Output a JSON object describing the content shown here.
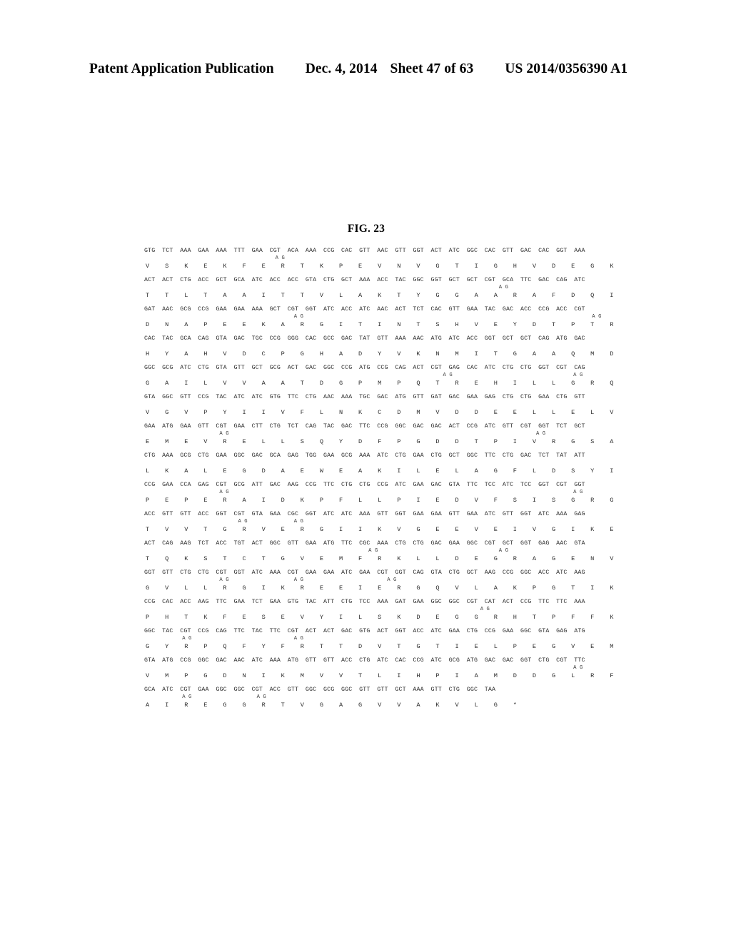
{
  "header": {
    "publication": "Patent Application Publication",
    "date": "Dec. 4, 2014",
    "sheet": "Sheet 47 of 63",
    "document_number": "US 2014/0356390 A1"
  },
  "figure": {
    "title": "FIG. 23",
    "mutation_annotation": "A G",
    "stop_symbol": "*",
    "rows": [
      {
        "codons": [
          "GTG",
          "TCT",
          "AAA",
          "GAA",
          "AAA",
          "TTT",
          "GAA",
          "CGT",
          "ACA",
          "AAA",
          "CCG",
          "CAC",
          "GTT",
          "AAC",
          "GTT",
          "GGT",
          "ACT",
          "ATC",
          "GGC",
          "CAC",
          "GTT",
          "GAC",
          "CAC",
          "GGT",
          "AAA"
        ],
        "mutations": [
          7
        ],
        "aminos": [
          "V",
          "S",
          "K",
          "E",
          "K",
          "F",
          "E",
          "R",
          "T",
          "K",
          "P",
          "E",
          "V",
          "N",
          "V",
          "G",
          "T",
          "I",
          "G",
          "H",
          "V",
          "D",
          "E",
          "G",
          "K"
        ]
      },
      {
        "codons": [
          "ACT",
          "ACT",
          "CTG",
          "ACC",
          "GCT",
          "GCA",
          "ATC",
          "ACC",
          "ACC",
          "GTA",
          "CTG",
          "GCT",
          "AAA",
          "ACC",
          "TAC",
          "GGC",
          "GGT",
          "GCT",
          "GCT",
          "CGT",
          "GCA",
          "TTC",
          "GAC",
          "CAG",
          "ATC"
        ],
        "mutations": [
          19
        ],
        "aminos": [
          "T",
          "T",
          "L",
          "T",
          "A",
          "A",
          "I",
          "T",
          "T",
          "V",
          "L",
          "A",
          "K",
          "T",
          "Y",
          "G",
          "G",
          "A",
          "A",
          "R",
          "A",
          "F",
          "D",
          "Q",
          "I"
        ]
      },
      {
        "codons": [
          "GAT",
          "AAC",
          "GCG",
          "CCG",
          "GAA",
          "GAA",
          "AAA",
          "GCT",
          "CGT",
          "GGT",
          "ATC",
          "ACC",
          "ATC",
          "AAC",
          "ACT",
          "TCT",
          "CAC",
          "GTT",
          "GAA",
          "TAC",
          "GAC",
          "ACC",
          "CCG",
          "ACC",
          "CGT"
        ],
        "mutations": [
          8,
          24
        ],
        "aminos": [
          "D",
          "N",
          "A",
          "P",
          "E",
          "E",
          "K",
          "A",
          "R",
          "G",
          "I",
          "T",
          "I",
          "N",
          "T",
          "S",
          "H",
          "V",
          "E",
          "Y",
          "D",
          "T",
          "P",
          "T",
          "R"
        ]
      },
      {
        "codons": [
          "CAC",
          "TAC",
          "GCA",
          "CAG",
          "GTA",
          "GAC",
          "TGC",
          "CCG",
          "GGG",
          "CAC",
          "GCC",
          "GAC",
          "TAT",
          "GTT",
          "AAA",
          "AAC",
          "ATG",
          "ATC",
          "ACC",
          "GGT",
          "GCT",
          "GCT",
          "CAG",
          "ATG",
          "GAC"
        ],
        "mutations": [],
        "aminos": [
          "H",
          "Y",
          "A",
          "H",
          "V",
          "D",
          "C",
          "P",
          "G",
          "H",
          "A",
          "D",
          "Y",
          "V",
          "K",
          "N",
          "M",
          "I",
          "T",
          "G",
          "A",
          "A",
          "Q",
          "M",
          "D"
        ]
      },
      {
        "codons": [
          "GGC",
          "GCG",
          "ATC",
          "CTG",
          "GTA",
          "GTT",
          "GCT",
          "GCG",
          "ACT",
          "GAC",
          "GGC",
          "CCG",
          "ATG",
          "CCG",
          "CAG",
          "ACT",
          "CGT",
          "GAG",
          "CAC",
          "ATC",
          "CTG",
          "CTG",
          "GGT",
          "CGT",
          "CAG"
        ],
        "mutations": [
          16,
          23
        ],
        "aminos": [
          "G",
          "A",
          "I",
          "L",
          "V",
          "V",
          "A",
          "A",
          "T",
          "D",
          "G",
          "P",
          "M",
          "P",
          "Q",
          "T",
          "R",
          "E",
          "H",
          "I",
          "L",
          "L",
          "G",
          "R",
          "Q"
        ]
      },
      {
        "codons": [
          "GTA",
          "GGC",
          "GTT",
          "CCG",
          "TAC",
          "ATC",
          "ATC",
          "GTG",
          "TTC",
          "CTG",
          "AAC",
          "AAA",
          "TGC",
          "GAC",
          "ATG",
          "GTT",
          "GAT",
          "GAC",
          "GAA",
          "GAG",
          "CTG",
          "CTG",
          "GAA",
          "CTG",
          "GTT"
        ],
        "mutations": [],
        "aminos": [
          "V",
          "G",
          "V",
          "P",
          "Y",
          "I",
          "I",
          "V",
          "F",
          "L",
          "N",
          "K",
          "C",
          "D",
          "M",
          "V",
          "D",
          "D",
          "E",
          "E",
          "L",
          "L",
          "E",
          "L",
          "V"
        ]
      },
      {
        "codons": [
          "GAA",
          "ATG",
          "GAA",
          "GTT",
          "CGT",
          "GAA",
          "CTT",
          "CTG",
          "TCT",
          "CAG",
          "TAC",
          "GAC",
          "TTC",
          "CCG",
          "GGC",
          "GAC",
          "GAC",
          "ACT",
          "CCG",
          "ATC",
          "GTT",
          "CGT",
          "GGT",
          "TCT",
          "GCT"
        ],
        "mutations": [
          4,
          21
        ],
        "aminos": [
          "E",
          "M",
          "E",
          "V",
          "R",
          "E",
          "L",
          "L",
          "S",
          "Q",
          "Y",
          "D",
          "F",
          "P",
          "G",
          "D",
          "D",
          "T",
          "P",
          "I",
          "V",
          "R",
          "G",
          "S",
          "A"
        ]
      },
      {
        "codons": [
          "CTG",
          "AAA",
          "GCG",
          "CTG",
          "GAA",
          "GGC",
          "GAC",
          "GCA",
          "GAG",
          "TGG",
          "GAA",
          "GCG",
          "AAA",
          "ATC",
          "CTG",
          "GAA",
          "CTG",
          "GCT",
          "GGC",
          "TTC",
          "CTG",
          "GAC",
          "TCT",
          "TAT",
          "ATT"
        ],
        "mutations": [],
        "aminos": [
          "L",
          "K",
          "A",
          "L",
          "E",
          "G",
          "D",
          "A",
          "E",
          "W",
          "E",
          "A",
          "K",
          "I",
          "L",
          "E",
          "L",
          "A",
          "G",
          "F",
          "L",
          "D",
          "S",
          "Y",
          "I"
        ]
      },
      {
        "codons": [
          "CCG",
          "GAA",
          "CCA",
          "GAG",
          "CGT",
          "GCG",
          "ATT",
          "GAC",
          "AAG",
          "CCG",
          "TTC",
          "CTG",
          "CTG",
          "CCG",
          "ATC",
          "GAA",
          "GAC",
          "GTA",
          "TTC",
          "TCC",
          "ATC",
          "TCC",
          "GGT",
          "CGT",
          "GGT"
        ],
        "mutations": [
          4,
          23
        ],
        "aminos": [
          "P",
          "E",
          "P",
          "E",
          "R",
          "A",
          "I",
          "D",
          "K",
          "P",
          "F",
          "L",
          "L",
          "P",
          "I",
          "E",
          "D",
          "V",
          "F",
          "S",
          "I",
          "S",
          "G",
          "R",
          "G"
        ]
      },
      {
        "codons": [
          "ACC",
          "GTT",
          "GTT",
          "ACC",
          "GGT",
          "CGT",
          "GTA",
          "GAA",
          "CGC",
          "GGT",
          "ATC",
          "ATC",
          "AAA",
          "GTT",
          "GGT",
          "GAA",
          "GAA",
          "GTT",
          "GAA",
          "ATC",
          "GTT",
          "GGT",
          "ATC",
          "AAA",
          "GAG"
        ],
        "mutations": [
          5,
          8
        ],
        "aminos": [
          "T",
          "V",
          "V",
          "T",
          "G",
          "R",
          "V",
          "E",
          "R",
          "G",
          "I",
          "I",
          "K",
          "V",
          "G",
          "E",
          "E",
          "V",
          "E",
          "I",
          "V",
          "G",
          "I",
          "K",
          "E"
        ]
      },
      {
        "codons": [
          "ACT",
          "CAG",
          "AAG",
          "TCT",
          "ACC",
          "TGT",
          "ACT",
          "GGC",
          "GTT",
          "GAA",
          "ATG",
          "TTC",
          "CGC",
          "AAA",
          "CTG",
          "CTG",
          "GAC",
          "GAA",
          "GGC",
          "CGT",
          "GCT",
          "GGT",
          "GAG",
          "AAC",
          "GTA"
        ],
        "mutations": [
          12,
          19
        ],
        "aminos": [
          "T",
          "Q",
          "K",
          "S",
          "T",
          "C",
          "T",
          "G",
          "V",
          "E",
          "M",
          "F",
          "R",
          "K",
          "L",
          "L",
          "D",
          "E",
          "G",
          "R",
          "A",
          "G",
          "E",
          "N",
          "V"
        ]
      },
      {
        "codons": [
          "GGT",
          "GTT",
          "CTG",
          "CTG",
          "CGT",
          "GGT",
          "ATC",
          "AAA",
          "CGT",
          "GAA",
          "GAA",
          "ATC",
          "GAA",
          "CGT",
          "GGT",
          "CAG",
          "GTA",
          "CTG",
          "GCT",
          "AAG",
          "CCG",
          "GGC",
          "ACC",
          "ATC",
          "AAG"
        ],
        "mutations": [
          4,
          8,
          13
        ],
        "aminos": [
          "G",
          "V",
          "L",
          "L",
          "R",
          "G",
          "I",
          "K",
          "R",
          "E",
          "E",
          "I",
          "E",
          "R",
          "G",
          "Q",
          "V",
          "L",
          "A",
          "K",
          "P",
          "G",
          "T",
          "I",
          "K"
        ]
      },
      {
        "codons": [
          "CCG",
          "CAC",
          "ACC",
          "AAG",
          "TTC",
          "GAA",
          "TCT",
          "GAA",
          "GTG",
          "TAC",
          "ATT",
          "CTG",
          "TCC",
          "AAA",
          "GAT",
          "GAA",
          "GGC",
          "GGC",
          "CGT",
          "CAT",
          "ACT",
          "CCG",
          "TTC",
          "TTC",
          "AAA"
        ],
        "mutations": [
          18
        ],
        "aminos": [
          "P",
          "H",
          "T",
          "K",
          "F",
          "E",
          "S",
          "E",
          "V",
          "Y",
          "I",
          "L",
          "S",
          "K",
          "D",
          "E",
          "G",
          "G",
          "R",
          "H",
          "T",
          "P",
          "F",
          "F",
          "K"
        ]
      },
      {
        "codons": [
          "GGC",
          "TAC",
          "CGT",
          "CCG",
          "CAG",
          "TTC",
          "TAC",
          "TTC",
          "CGT",
          "ACT",
          "ACT",
          "GAC",
          "GTG",
          "ACT",
          "GGT",
          "ACC",
          "ATC",
          "GAA",
          "CTG",
          "CCG",
          "GAA",
          "GGC",
          "GTA",
          "GAG",
          "ATG"
        ],
        "mutations": [
          2,
          8
        ],
        "aminos": [
          "G",
          "Y",
          "R",
          "P",
          "Q",
          "F",
          "Y",
          "F",
          "R",
          "T",
          "T",
          "D",
          "V",
          "T",
          "G",
          "T",
          "I",
          "E",
          "L",
          "P",
          "E",
          "G",
          "V",
          "E",
          "M"
        ]
      },
      {
        "codons": [
          "GTA",
          "ATG",
          "CCG",
          "GGC",
          "GAC",
          "AAC",
          "ATC",
          "AAA",
          "ATG",
          "GTT",
          "GTT",
          "ACC",
          "CTG",
          "ATC",
          "CAC",
          "CCG",
          "ATC",
          "GCG",
          "ATG",
          "GAC",
          "GAC",
          "GGT",
          "CTG",
          "CGT",
          "TTC"
        ],
        "mutations": [
          23
        ],
        "aminos": [
          "V",
          "M",
          "P",
          "G",
          "D",
          "N",
          "I",
          "K",
          "M",
          "V",
          "V",
          "T",
          "L",
          "I",
          "H",
          "P",
          "I",
          "A",
          "M",
          "D",
          "D",
          "G",
          "L",
          "R",
          "F"
        ]
      },
      {
        "codons": [
          "GCA",
          "ATC",
          "CGT",
          "GAA",
          "GGC",
          "GGC",
          "CGT",
          "ACC",
          "GTT",
          "GGC",
          "GCG",
          "GGC",
          "GTT",
          "GTT",
          "GCT",
          "AAA",
          "GTT",
          "CTG",
          "GGC",
          "TAA"
        ],
        "mutations": [
          2,
          6
        ],
        "aminos": [
          "A",
          "I",
          "R",
          "E",
          "G",
          "G",
          "R",
          "T",
          "V",
          "G",
          "A",
          "G",
          "V",
          "V",
          "A",
          "K",
          "V",
          "L",
          "G",
          "*"
        ]
      }
    ]
  }
}
